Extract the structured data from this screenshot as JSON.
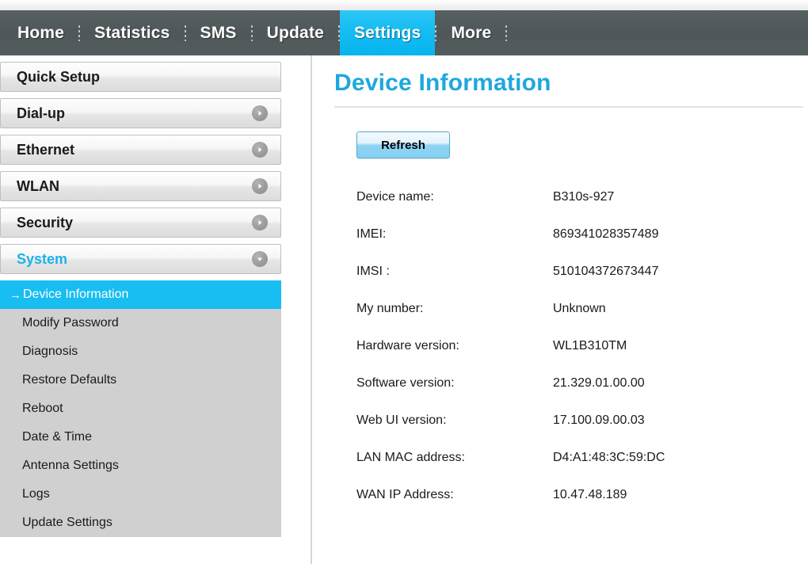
{
  "navbar": {
    "items": [
      {
        "label": "Home",
        "active": false
      },
      {
        "label": "Statistics",
        "active": false
      },
      {
        "label": "SMS",
        "active": false
      },
      {
        "label": "Update",
        "active": false
      },
      {
        "label": "Settings",
        "active": true
      },
      {
        "label": "More",
        "active": false
      }
    ],
    "active_color": "#0fb9f0",
    "bar_color": "#525b5d"
  },
  "sidebar": {
    "groups": [
      {
        "label": "Quick Setup",
        "icon": "none",
        "expanded": false
      },
      {
        "label": "Dial-up",
        "icon": "chevron-right-icon",
        "expanded": false
      },
      {
        "label": "Ethernet",
        "icon": "chevron-right-icon",
        "expanded": false
      },
      {
        "label": "WLAN",
        "icon": "chevron-right-icon",
        "expanded": false
      },
      {
        "label": "Security",
        "icon": "chevron-right-icon",
        "expanded": false
      },
      {
        "label": "System",
        "icon": "chevron-down-icon",
        "expanded": true
      }
    ],
    "submenu": [
      {
        "label": "Device Information",
        "active": true,
        "marker": "→"
      },
      {
        "label": "Modify Password",
        "active": false
      },
      {
        "label": "Diagnosis",
        "active": false
      },
      {
        "label": "Restore Defaults",
        "active": false
      },
      {
        "label": "Reboot",
        "active": false
      },
      {
        "label": "Date & Time",
        "active": false
      },
      {
        "label": "Antenna Settings",
        "active": false
      },
      {
        "label": "Logs",
        "active": false
      },
      {
        "label": "Update Settings",
        "active": false
      }
    ]
  },
  "content": {
    "title": "Device Information",
    "refresh_label": "Refresh",
    "title_color": "#1fa7dd",
    "rows": [
      {
        "label": "Device name:",
        "value": "B310s-927"
      },
      {
        "label": "IMEI:",
        "value": "869341028357489"
      },
      {
        "label": "IMSI :",
        "value": "510104372673447"
      },
      {
        "label": "My number:",
        "value": "Unknown"
      },
      {
        "label": "Hardware version:",
        "value": "WL1B310TM"
      },
      {
        "label": "Software version:",
        "value": "21.329.01.00.00"
      },
      {
        "label": "Web UI version:",
        "value": "17.100.09.00.03"
      },
      {
        "label": "LAN MAC address:",
        "value": "D4:A1:48:3C:59:DC"
      },
      {
        "label": "WAN IP Address:",
        "value": "10.47.48.189"
      }
    ]
  }
}
